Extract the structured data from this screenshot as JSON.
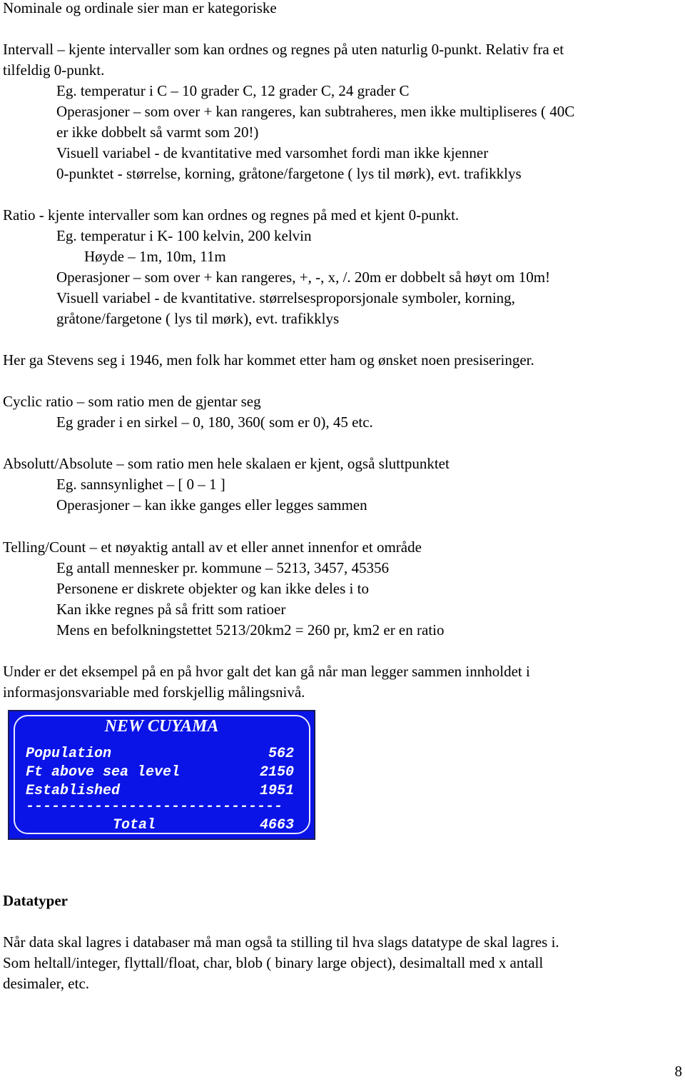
{
  "document": {
    "lines": {
      "nominal": "Nominale og ordinale sier man er kategoriske",
      "interval_1": "Intervall – kjente intervaller som kan ordnes og regnes på uten naturlig 0-punkt. Relativ fra et",
      "interval_2": "tilfeldig 0-punkt.",
      "interval_eg": "Eg. temperatur i C – 10 grader C, 12 grader C, 24 grader C",
      "interval_ops_1": "Operasjoner – som over +  kan rangeres, kan subtraheres, men ikke multipliseres ( 40C",
      "interval_ops_2": "er ikke dobbelt så varmt som 20!)",
      "interval_vis_1": "Visuell variabel - de kvantitative med varsomhet fordi man ikke kjenner",
      "interval_vis_2": "0-punktet - størrelse, korning, gråtone/fargetone ( lys til mørk), evt. trafikklys",
      "ratio": "Ratio - kjente intervaller som kan ordnes og regnes på med et kjent 0-punkt.",
      "ratio_eg": "Eg. temperatur i K- 100 kelvin, 200 kelvin",
      "ratio_height": "Høyde – 1m, 10m, 11m",
      "ratio_ops": "Operasjoner – som over + kan rangeres, +, -, x, /. 20m er dobbelt så høyt om 10m!",
      "ratio_vis_1": "Visuell variabel - de kvantitative. størrelsesproporsjonale symboler, korning,",
      "ratio_vis_2": "gråtone/fargetone ( lys til mørk), evt. trafikklys",
      "stevens": "Her ga Stevens seg i 1946, men folk har kommet etter ham og ønsket noen presiseringer.",
      "cyclic": "Cyclic ratio – som ratio men de gjentar seg",
      "cyclic_eg": "Eg grader i en sirkel – 0, 180, 360( som er 0), 45 etc.",
      "absolute": "Absolutt/Absolute – som ratio men hele skalaen er kjent, også sluttpunktet",
      "absolute_eg": "Eg. sannsynlighet – [ 0 – 1 ]",
      "absolute_ops": "Operasjoner – kan ikke ganges eller legges sammen",
      "count": "Telling/Count – et nøyaktig antall av et eller annet innenfor et område",
      "count_eg": "Eg antall mennesker pr. kommune – 5213, 3457, 45356",
      "count_discrete": "Personene er diskrete objekter og kan ikke deles i to",
      "count_calc": "Kan ikke regnes på så fritt som ratioer",
      "count_density": "Mens en befolkningstettet 5213/20km2 = 260 pr, km2 er en ratio",
      "example_1": "Under er det eksempel på en på hvor galt det kan gå når man legger sammen innholdet i",
      "example_2": "informasjonsvariable med forskjellig målingsnivå.",
      "datatypes_heading": "Datatyper",
      "datatypes_1": "Når data skal lagres i databaser må man også ta stilling til hva slags datatype de skal lagres i.",
      "datatypes_2": "Som heltall/integer, flyttall/float, char, blob ( binary large object), desimaltall med x antall",
      "datatypes_3": "desimaler, etc."
    },
    "sign": {
      "title": "NEW CUYAMA",
      "rows": [
        {
          "label": "Population",
          "value": "562"
        },
        {
          "label": "Ft above sea level",
          "value": "2150"
        },
        {
          "label": "Established",
          "value": "1951"
        }
      ],
      "divider": "------------------------------",
      "total_label": "Total",
      "total_value": "4663",
      "colors": {
        "background": "#0a14e6",
        "text": "#ffffff"
      }
    },
    "page_number": "8"
  }
}
